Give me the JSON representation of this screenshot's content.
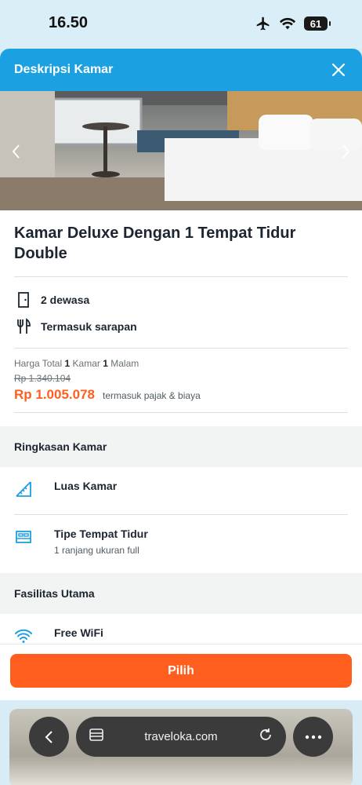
{
  "status_bar": {
    "time": "16.50",
    "battery": "61"
  },
  "header": {
    "title": "Deskripsi Kamar"
  },
  "room": {
    "title": "Kamar Deluxe Dengan 1 Tempat Tidur Double"
  },
  "features": [
    {
      "icon": "door-icon",
      "label": "2 dewasa"
    },
    {
      "icon": "cutlery-icon",
      "label": "Termasuk sarapan"
    }
  ],
  "price": {
    "label_prefix": "Harga Total",
    "rooms_count": "1",
    "rooms_word": "Kamar",
    "nights_count": "1",
    "nights_word": "Malam",
    "original": "Rp 1.340.104",
    "final": "Rp 1.005.078",
    "note": "termasuk pajak & biaya"
  },
  "summary": {
    "heading": "Ringkasan Kamar",
    "items": [
      {
        "icon": "ruler-icon",
        "title": "Luas Kamar",
        "subtitle": ""
      },
      {
        "icon": "bed-icon",
        "title": "Tipe Tempat Tidur",
        "subtitle": "1 ranjang ukuran full"
      }
    ]
  },
  "facilities": {
    "heading": "Fasilitas Utama",
    "items": [
      {
        "icon": "wifi-icon",
        "title": "Free WiFi"
      }
    ]
  },
  "footer": {
    "button_label": "Pilih"
  },
  "browser": {
    "url": "traveloka.com"
  },
  "colors": {
    "header_blue": "#1ba0e2",
    "accent_orange": "#ff5e1f"
  }
}
